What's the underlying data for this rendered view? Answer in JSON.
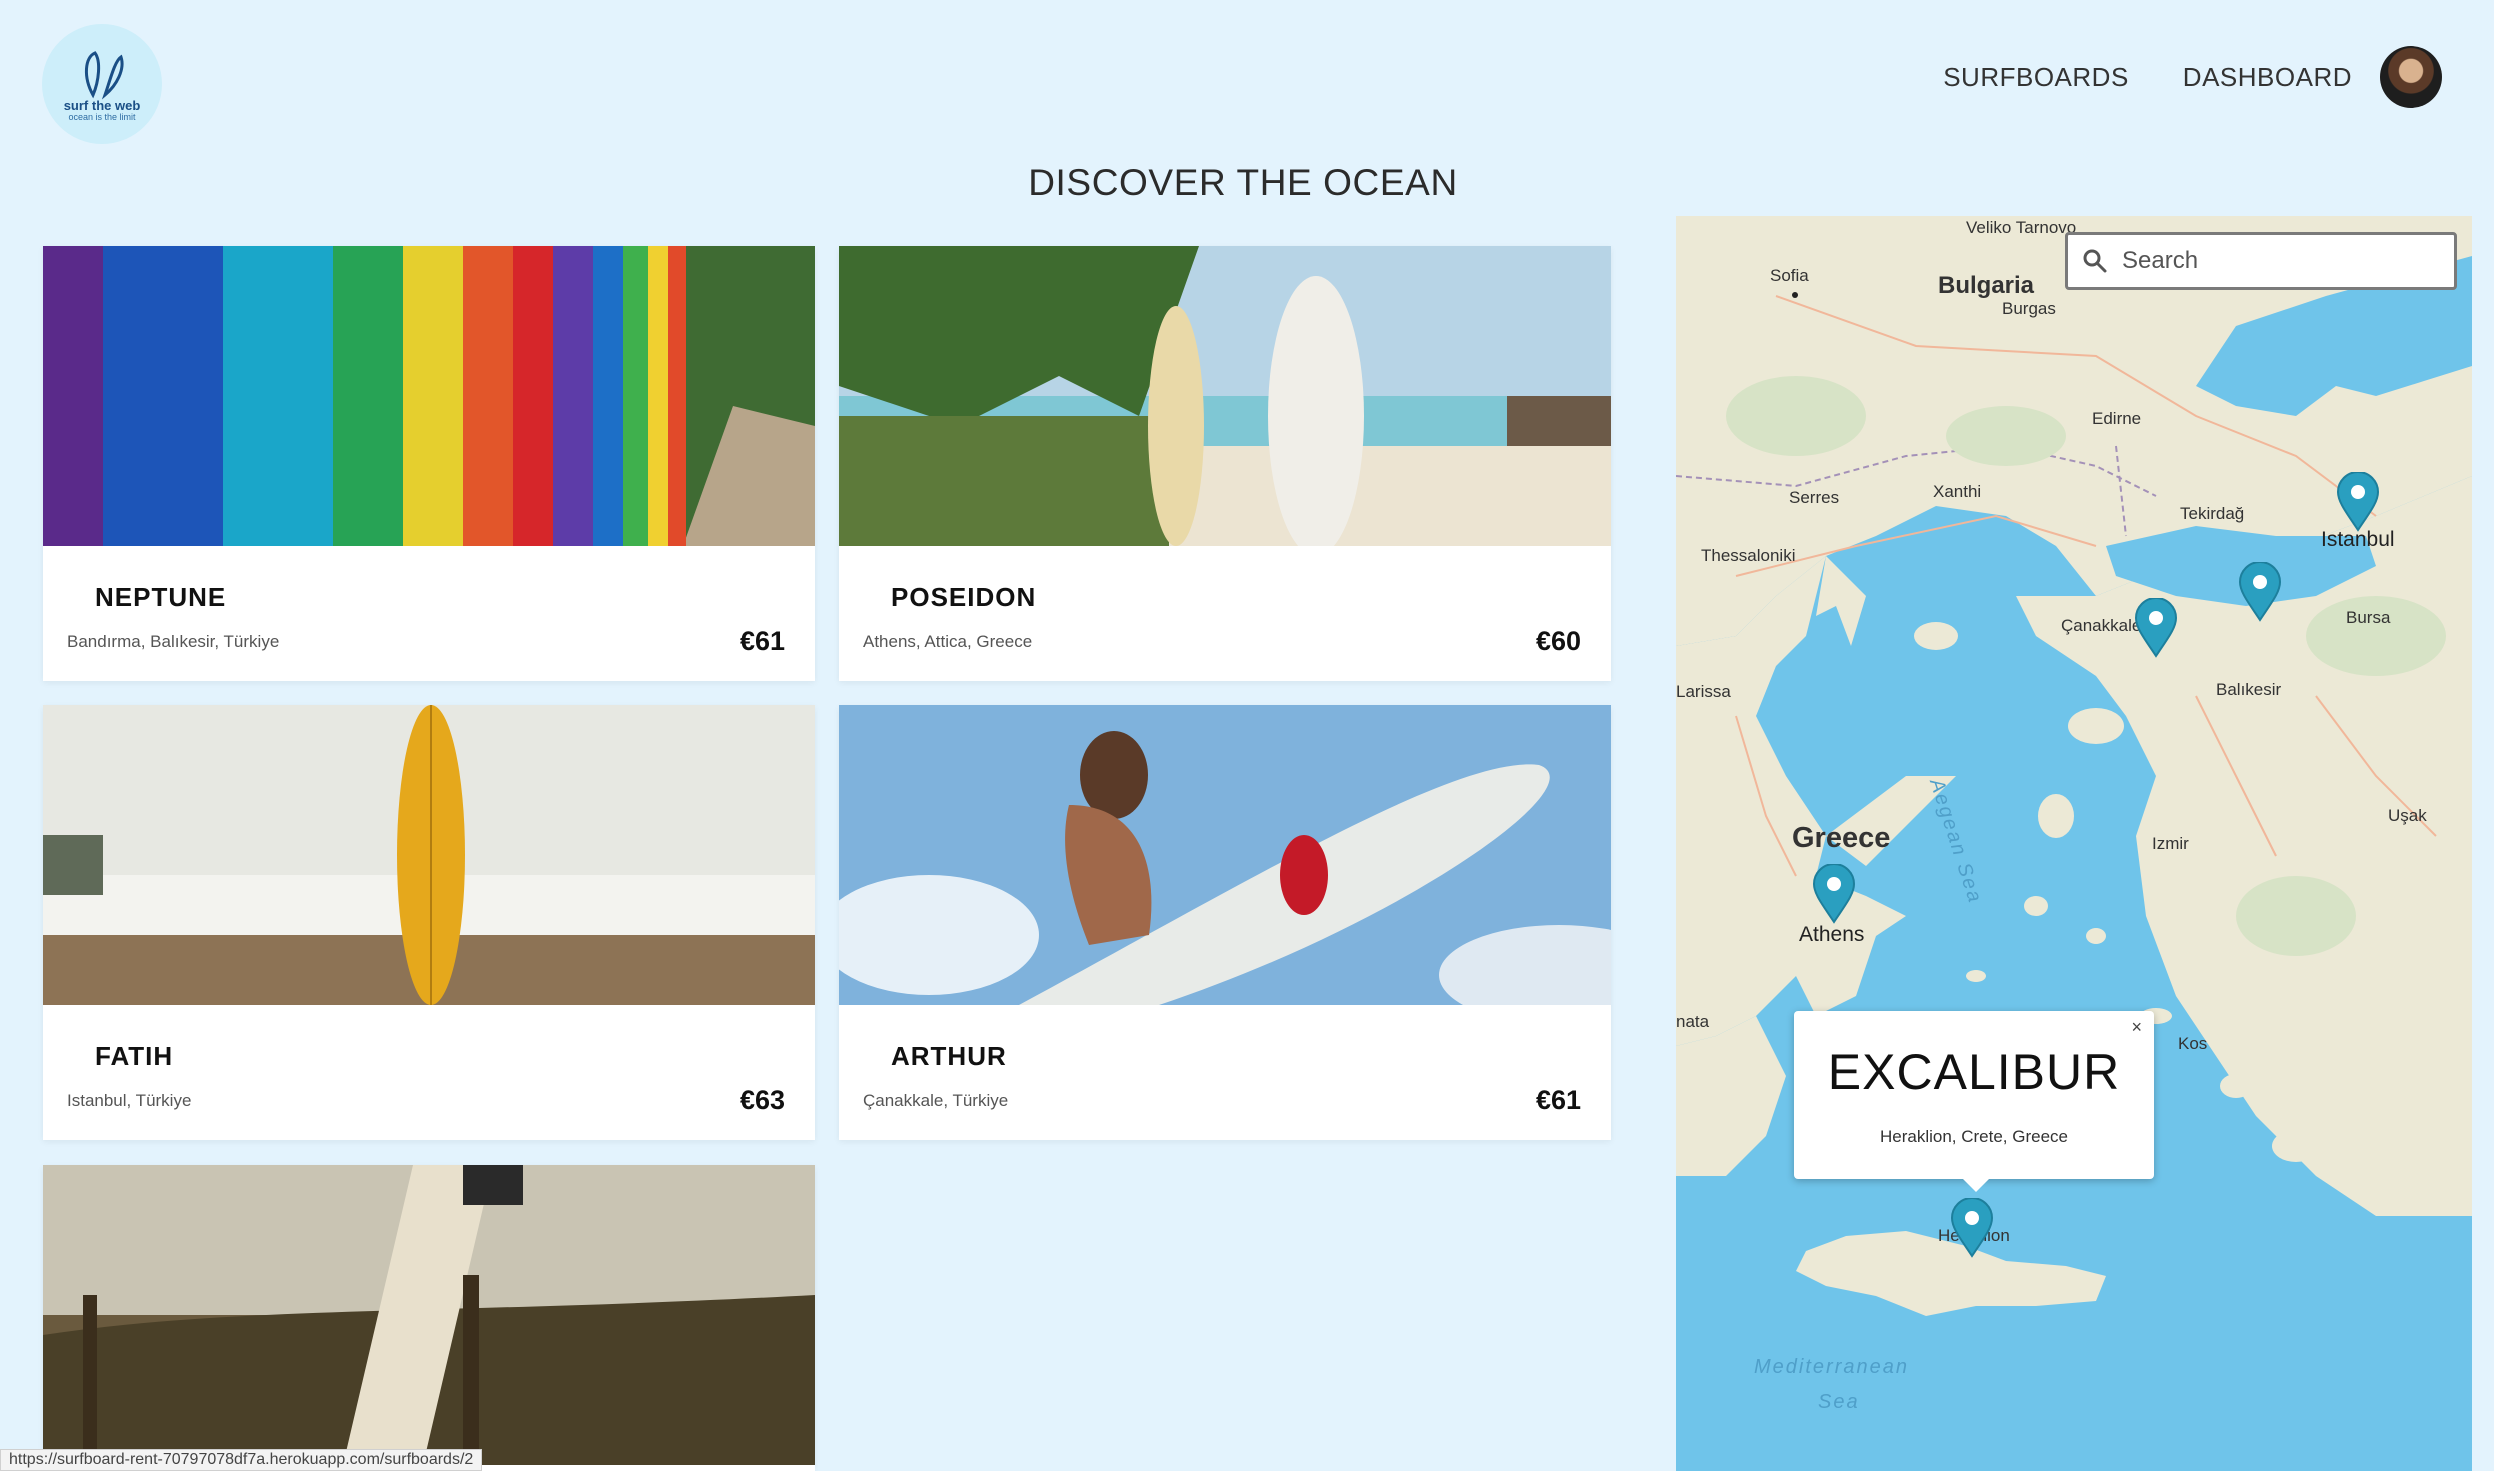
{
  "brand": {
    "name": "surf the web",
    "tagline": "ocean is the limit"
  },
  "nav": {
    "surfboards": "SURFBOARDS",
    "dashboard": "DASHBOARD"
  },
  "page": {
    "title": "DISCOVER THE OCEAN"
  },
  "cards": [
    {
      "name": "NEPTUNE",
      "address": "Bandırma, Balıkesir, Türkiye",
      "price": "€61"
    },
    {
      "name": "POSEIDON",
      "address": "Athens, Attica, Greece",
      "price": "€60"
    },
    {
      "name": "FATIH",
      "address": "Istanbul, Türkiye",
      "price": "€63"
    },
    {
      "name": "ARTHUR",
      "address": "Çanakkale, Türkiye",
      "price": "€61"
    }
  ],
  "map": {
    "search_placeholder": "Search",
    "popup": {
      "title": "EXCALIBUR",
      "address": "Heraklion, Crete, Greece",
      "close": "×"
    },
    "labels": {
      "veliko": "Veliko Tarnovo",
      "sofia": "Sofia",
      "bulgaria": "Bulgaria",
      "burgas": "Burgas",
      "edirne": "Edirne",
      "serres": "Serres",
      "xanthi": "Xanthi",
      "tekirdag": "Tekirdağ",
      "istanbul": "Istanbul",
      "thessaloniki": "Thessaloniki",
      "canakkale": "Çanakkale",
      "bursa": "Bursa",
      "larissa": "Larissa",
      "balikesir": "Balıkesir",
      "aegean": "Aegean Sea",
      "usak": "Uşak",
      "greece": "Greece",
      "izmir": "Izmir",
      "athens": "Athens",
      "kalamata_partial": "nata",
      "kos": "Kos",
      "heraklion_partial": "Heraklion",
      "mediterranean": "Mediterranean",
      "sea": "Sea"
    },
    "pin_color": "#2a9fc0"
  },
  "status_bar": {
    "url": "https://surfboard-rent-70797078df7a.herokuapp.com/surfboards/2"
  },
  "colors": {
    "background": "#e3f3fd",
    "water": "#6fc4ea",
    "land": "#ece9d6"
  }
}
